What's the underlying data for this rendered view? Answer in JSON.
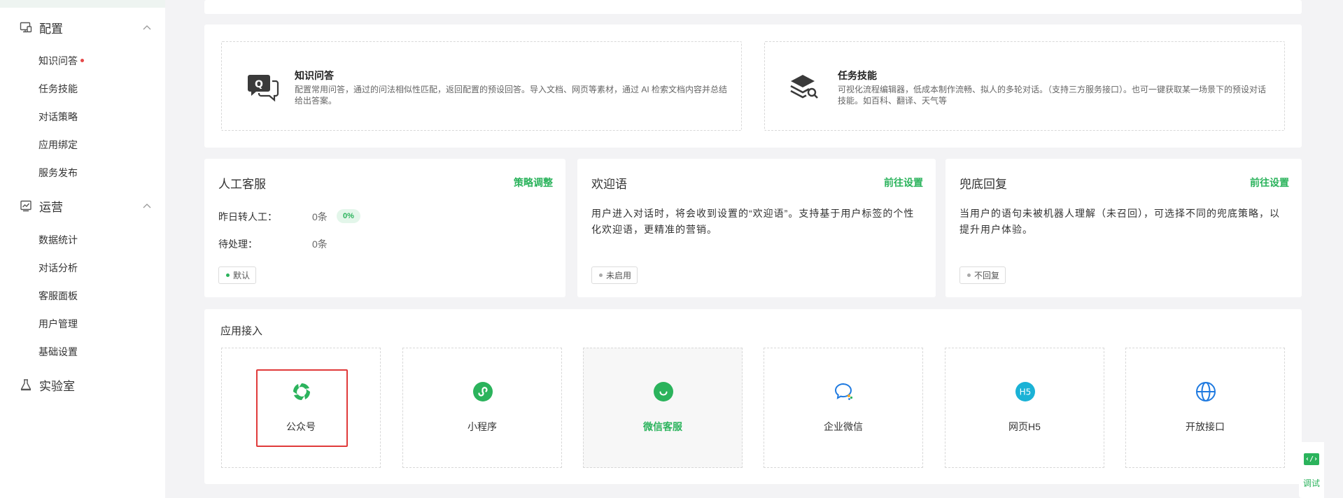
{
  "sidebar": {
    "sections": [
      {
        "label": "配置",
        "icon": "monitor-icon"
      },
      {
        "label": "运营",
        "icon": "chart-icon"
      },
      {
        "label": "实验室",
        "icon": "flask-icon"
      }
    ],
    "config_items": [
      "知识问答",
      "任务技能",
      "对话策略",
      "应用绑定",
      "服务发布"
    ],
    "ops_items": [
      "数据统计",
      "对话分析",
      "客服面板",
      "用户管理",
      "基础设置"
    ]
  },
  "skills": [
    {
      "title": "知识问答",
      "desc": "配置常用问答，通过的问法相似性匹配，返回配置的预设回答。导入文档、网页等素材，通过 AI 检索文档内容并总结给出答案。",
      "icon": "qa-bubble-icon"
    },
    {
      "title": "任务技能",
      "desc": "可视化流程编辑器，低成本制作流畅、拟人的多轮对话。（支持三方服务接口）。也可一键获取某一场景下的预设对话技能。如百科、翻译、天气等",
      "icon": "layers-search-icon"
    }
  ],
  "services": {
    "human": {
      "title": "人工客服",
      "link": "策略调整",
      "yesterday_label": "昨日转人工：",
      "yesterday_value": "0条",
      "pct": "0%",
      "pending_label": "待处理：",
      "pending_value": "0条",
      "tag": "默认"
    },
    "welcome": {
      "title": "欢迎语",
      "link": "前往设置",
      "text": "用户进入对话时，将会收到设置的“欢迎语”。支持基于用户标签的个性化欢迎语，更精准的营销。",
      "tag": "未启用"
    },
    "fallback": {
      "title": "兜底回复",
      "link": "前往设置",
      "text": "当用户的语句未被机器人理解（未召回），可选择不同的兜底策略，以提升用户体验。",
      "tag": "不回复"
    }
  },
  "apps": {
    "title": "应用接入",
    "items": [
      {
        "label": "公众号",
        "icon": "official-account-icon"
      },
      {
        "label": "小程序",
        "icon": "mini-program-icon"
      },
      {
        "label": "微信客服",
        "icon": "wechat-service-icon"
      },
      {
        "label": "企业微信",
        "icon": "wecom-icon"
      },
      {
        "label": "网页H5",
        "icon": "h5-icon",
        "badge": "H5"
      },
      {
        "label": "开放接口",
        "icon": "globe-icon"
      }
    ]
  },
  "debug": {
    "label": "调试",
    "icon": "code-icon",
    "glyph": "‹/›"
  },
  "colors": {
    "accent": "#2bb35c",
    "highlight": "#e03a3a",
    "dot": "#e54848"
  }
}
